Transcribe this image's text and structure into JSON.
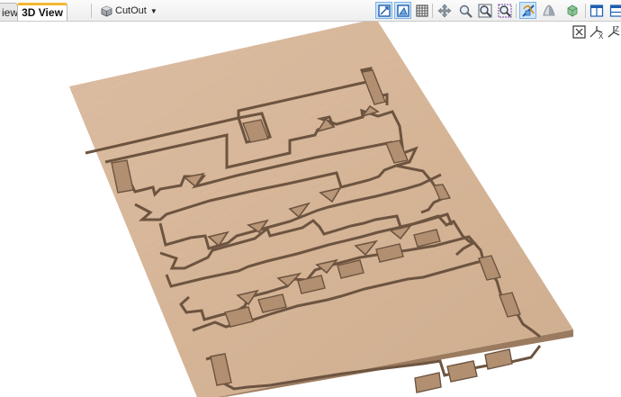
{
  "tabs": [
    {
      "label": "iew",
      "active": false
    },
    {
      "label": "3D View",
      "active": true
    }
  ],
  "toolbar": {
    "material_selector": {
      "label": "CutOut",
      "icon": "cube-icon"
    },
    "buttons": [
      {
        "name": "2d-view-icon",
        "active": true
      },
      {
        "name": "3d-view-icon",
        "active": true
      },
      {
        "name": "grid-icon",
        "active": false
      },
      {
        "name": "pan-icon",
        "active": false
      },
      {
        "name": "zoom-icon",
        "active": false
      },
      {
        "name": "zoom-extents-icon",
        "active": false
      },
      {
        "name": "zoom-box-icon",
        "active": false
      },
      {
        "name": "toolpath-preview-icon",
        "active": true
      },
      {
        "name": "shading-icon",
        "active": false
      },
      {
        "name": "render-material-icon",
        "active": false
      },
      {
        "name": "split-horizontal-icon",
        "active": false
      },
      {
        "name": "split-vertical-icon",
        "active": false
      }
    ]
  },
  "view_orientation": {
    "buttons": [
      "view-iso-icon",
      "view-x-icon",
      "view-z-icon"
    ]
  },
  "scene": {
    "material": "wood-plywood",
    "colors": {
      "top": "#d7b699",
      "edge": "#a88669",
      "background": "#ffffff",
      "slot_shadow": "#6d5440",
      "accent": "#f3b733",
      "active_button": "#cfe6fb"
    }
  }
}
